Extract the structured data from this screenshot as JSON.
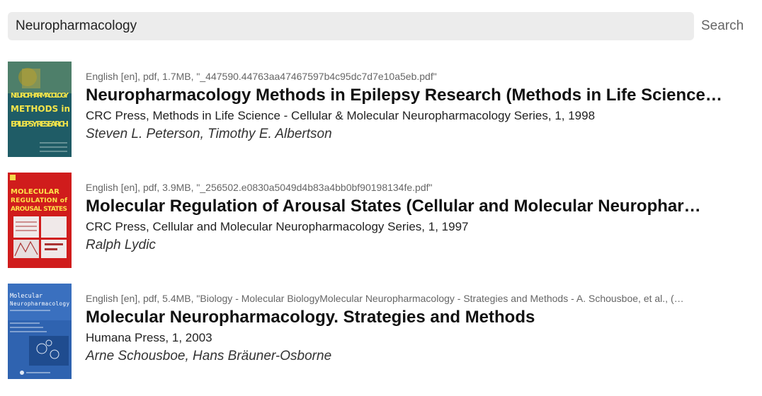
{
  "search": {
    "value": "Neuropharmacology",
    "button_label": "Search"
  },
  "results": [
    {
      "meta": "English [en], pdf, 1.7MB, \"_447590.44763aa47467597b4c95dc7d7e10a5eb.pdf\"",
      "title": "Neuropharmacology Methods in Epilepsy Research (Methods in Life Science…",
      "publisher": "CRC Press, Methods in Life Science - Cellular & Molecular Neuropharmacology Series, 1, 1998",
      "authors": "Steven L. Peterson, Timothy E. Albertson",
      "cover": {
        "lines": [
          "NEUROPHARMACOLOGY",
          "METHODS in",
          "EPILEPSY RESEARCH"
        ],
        "colors": {
          "bg": "#2f6b6a",
          "accent": "#9a8f2a",
          "text": "#f2e34a"
        }
      }
    },
    {
      "meta": "English [en], pdf, 3.9MB, \"_256502.e0830a5049d4b83a4bb0bf90198134fe.pdf\"",
      "title": "Molecular Regulation of Arousal States (Cellular and Molecular Neurophar…",
      "publisher": "CRC Press, Cellular and Molecular Neuropharmacology Series, 1, 1997",
      "authors": "Ralph Lydic",
      "cover": {
        "lines": [
          "MOLECULAR",
          "REGULATION of",
          "AROUSAL STATES"
        ],
        "colors": {
          "bg": "#d01c1c",
          "accent": "#f4f4f4",
          "text": "#ffe14a"
        }
      }
    },
    {
      "meta": "English [en], pdf, 5.4MB, \"Biology - Molecular BiologyMolecular Neuropharmacology - Strategies and Methods - A. Schousboe, et al., (…",
      "title": "Molecular Neuropharmacology. Strategies and Methods",
      "publisher": "Humana Press, 1, 2003",
      "authors": "Arne Schousboe, Hans Bräuner-Osborne",
      "cover": {
        "lines": [
          "Molecular",
          "Neuropharmacology"
        ],
        "colors": {
          "bg": "#2f63b0",
          "accent": "#dfe8f5",
          "text": "#ffffff"
        }
      }
    }
  ]
}
